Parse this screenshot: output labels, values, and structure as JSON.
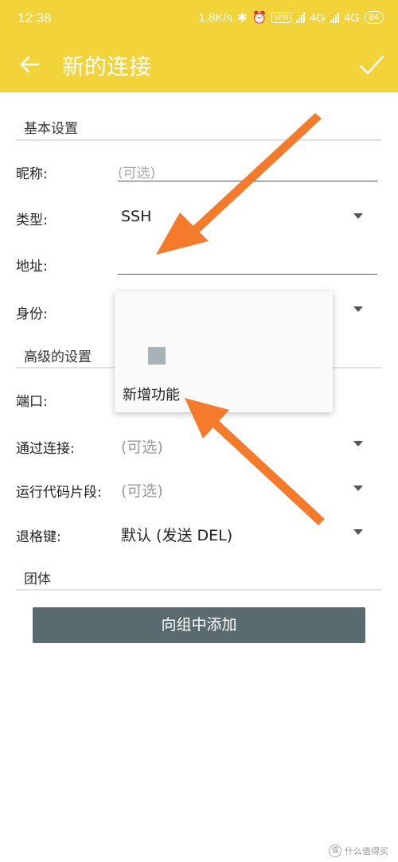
{
  "status_bar": {
    "time": "12:38",
    "speed": "1.8K/s",
    "vpn": "VPN",
    "net1": "4G",
    "net2": "4G",
    "battery": "84"
  },
  "app_bar": {
    "title": "新的连接"
  },
  "sections": {
    "basic": "基本设置",
    "advanced": "高级的设置",
    "group": "团体"
  },
  "fields": {
    "nickname_label": "昵称:",
    "nickname_placeholder": "(可选)",
    "type_label": "类型:",
    "type_value": "SSH",
    "address_label": "地址:",
    "identity_label": "身份:",
    "port_label": "端口:",
    "via_label": "通过连接:",
    "via_value": "(可选)",
    "snippet_label": "运行代码片段:",
    "snippet_value": "(可选)",
    "backspace_label": "退格键:",
    "backspace_value": "默认 (发送 DEL)"
  },
  "popup": {
    "item_label": "新增功能"
  },
  "button": {
    "add_group": "向组中添加"
  },
  "watermark": {
    "text": "什么值得买",
    "logo": "值"
  },
  "colors": {
    "accent": "#f2d33a",
    "annotation_arrow": "#f47a2c",
    "button": "#5a6b6f"
  }
}
